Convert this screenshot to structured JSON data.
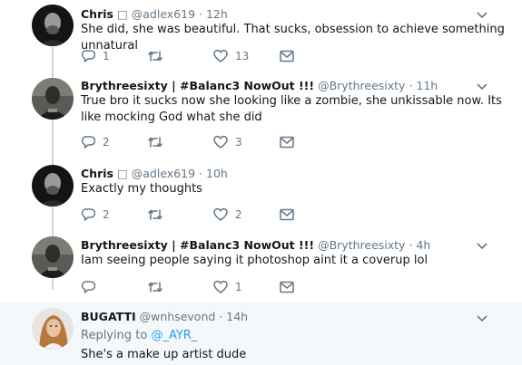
{
  "tweets": [
    {
      "name": "Chris",
      "badge": "□",
      "handle": "@adlex619",
      "time": "12h",
      "text": "She did, she was beautiful. That sucks, obsession to achieve something unnatural",
      "replies": "1",
      "retweets": "",
      "likes": "13"
    },
    {
      "name": "Brythreesixty | #Balanc3 NowOut !!!",
      "handle": "@Brythreesixty",
      "time": "11h",
      "text": "True bro it sucks now she looking like a zombie, she unkissable now. Its like mocking God what she did",
      "replies": "2",
      "retweets": "",
      "likes": "3"
    },
    {
      "name": "Chris",
      "badge": "□",
      "handle": "@adlex619",
      "time": "10h",
      "text": "Exactly my thoughts",
      "replies": "2",
      "retweets": "",
      "likes": "2"
    },
    {
      "name": "Brythreesixty | #Balanc3 NowOut !!!",
      "handle": "@Brythreesixty",
      "time": "4h",
      "text": "Iam seeing people saying it photoshop aint it a coverup lol",
      "replies": "",
      "retweets": "",
      "likes": "1"
    },
    {
      "name": "BUGATTI",
      "handle": "@wnhsevond",
      "time": "14h",
      "replying_prefix": "Replying to ",
      "replying_handle": "@_AYR_",
      "text": "She's a make up artist dude"
    }
  ],
  "separator": "·",
  "icons": {
    "reply": "speech-bubble-icon",
    "retweet": "retweet-icon",
    "like": "heart-icon",
    "dm": "envelope-icon",
    "more": "chevron-down-icon"
  },
  "colors": {
    "link": "#1da1f2",
    "muted": "#657786",
    "thread_line": "#ccd6dd",
    "highlight_bg": "#f5f8fa"
  }
}
